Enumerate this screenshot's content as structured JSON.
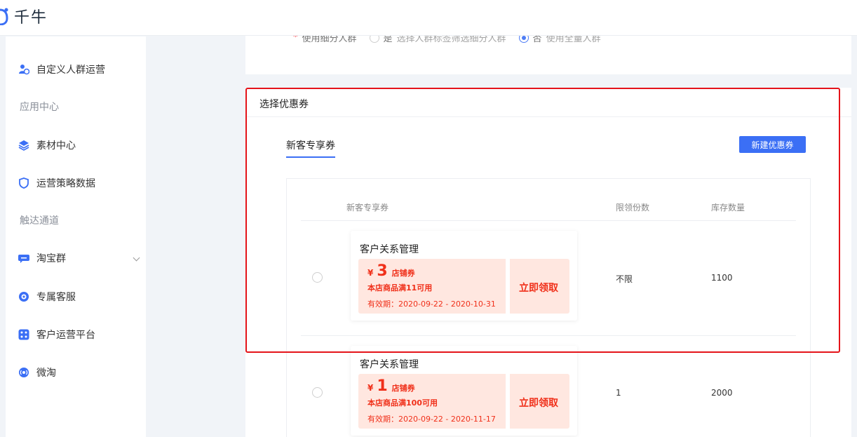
{
  "app": {
    "name": "千牛"
  },
  "sidebar": {
    "items": [
      {
        "label": "自定义人群运营",
        "icon": "people-icon"
      },
      {
        "label": "素材中心",
        "icon": "layers-icon"
      },
      {
        "label": "运营策略数据",
        "icon": "shield-icon"
      },
      {
        "label": "淘宝群",
        "icon": "chat-icon"
      },
      {
        "label": "专属客服",
        "icon": "service-icon"
      },
      {
        "label": "客户运营平台",
        "icon": "platform-icon"
      },
      {
        "label": "微淘",
        "icon": "broadcast-icon"
      }
    ],
    "sections": [
      "应用中心",
      "触达通道"
    ]
  },
  "crowd": {
    "required_mark": "*",
    "label": "使用细分人群",
    "option_yes": "是",
    "option_yes_hint": "选择人群标签筛选细分人群",
    "option_no": "否",
    "option_no_hint": "使用全量人群"
  },
  "coupon_section": {
    "title": "选择优惠券",
    "tab": "新客专享券",
    "new_button": "新建优惠券",
    "columns": [
      "新客专享券",
      "限领份数",
      "库存数量"
    ],
    "rows": [
      {
        "shop": "客户关系管理",
        "currency": "¥",
        "amount": "3",
        "type": "店铺券",
        "condition": "本店商品满11可用",
        "validity": "有效期：2020-09-22 - 2020-10-31",
        "claim": "立即领取",
        "limit": "不限",
        "stock": "1100"
      },
      {
        "shop": "客户关系管理",
        "currency": "¥",
        "amount": "1",
        "type": "店铺券",
        "condition": "本店商品满100可用",
        "validity": "有效期：2020-09-22 - 2020-11-17",
        "claim": "立即领取",
        "limit": "1",
        "stock": "2000"
      }
    ]
  },
  "colors": {
    "accent": "#3b6ff5",
    "coupon_red": "#f0301a",
    "coupon_bg": "#ffe7e0",
    "highlight": "#e5141a"
  }
}
